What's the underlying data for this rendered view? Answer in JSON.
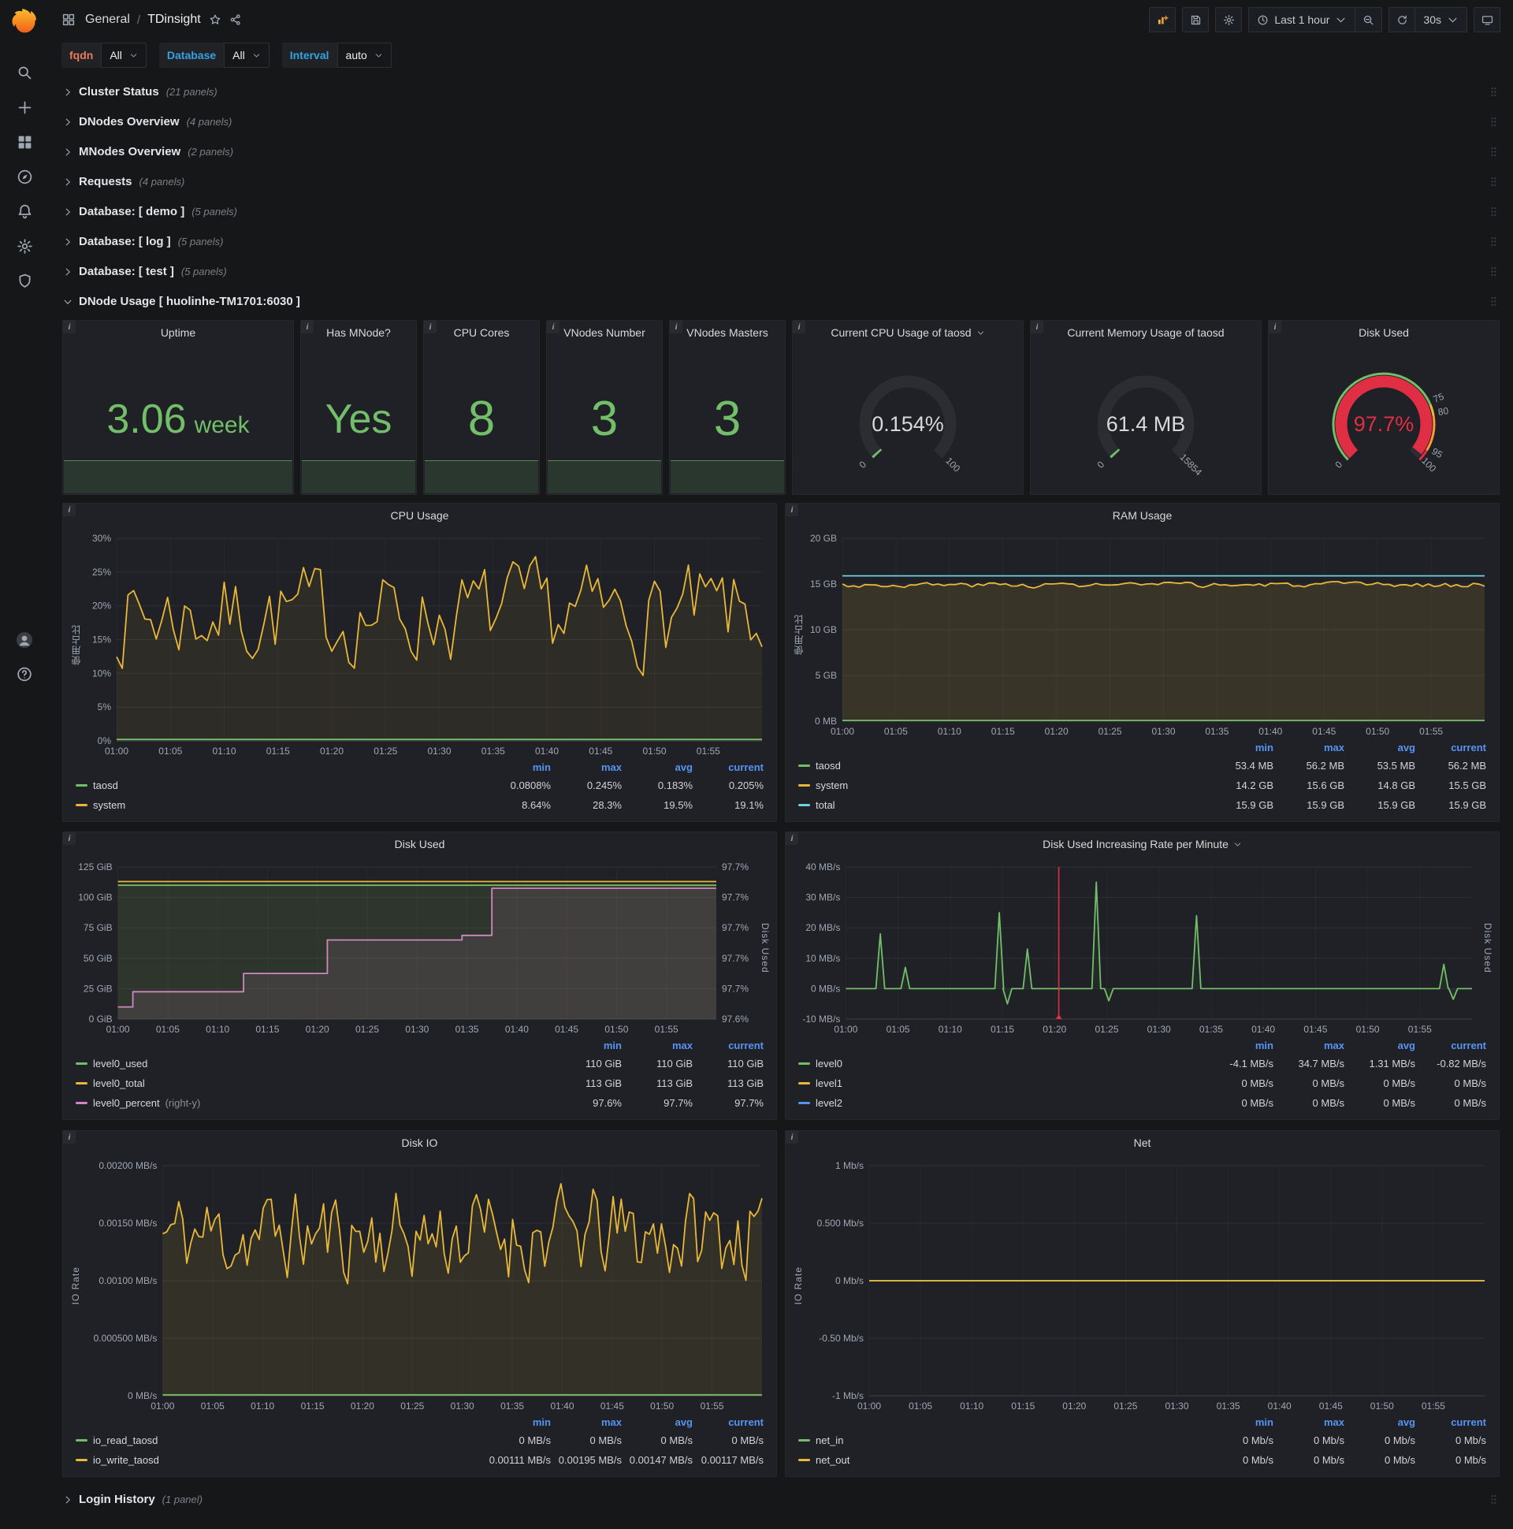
{
  "colors": {
    "green": "#73bf69",
    "yellow": "#eab839",
    "blue": "#6ed0e0",
    "series_blue": "#5794f2",
    "pink": "#d683ce",
    "red": "#e02f44",
    "legend_header": "#5794f2",
    "axis_text": "#9fa7b3",
    "fqdn_label": "#eb7b59",
    "var_label": "#33a2e5"
  },
  "navbar": {
    "breadcrumb": {
      "section": "General",
      "separator": "/",
      "title": "TDinsight"
    },
    "time_range_label": "Last 1 hour",
    "refresh_label": "30s"
  },
  "sidebar_icons": [
    {
      "name": "search-icon",
      "glyph": "search"
    },
    {
      "name": "create-icon",
      "glyph": "plus"
    },
    {
      "name": "dashboards-icon",
      "glyph": "dashboards"
    },
    {
      "name": "explore-icon",
      "glyph": "explore"
    },
    {
      "name": "alerting-icon",
      "glyph": "alerting"
    },
    {
      "name": "configuration-icon",
      "glyph": "settings"
    },
    {
      "name": "server-admin-icon",
      "glyph": "shield"
    }
  ],
  "sidebar_bottom": [
    {
      "name": "user-avatar",
      "glyph": "avatar"
    },
    {
      "name": "help-icon",
      "glyph": "help"
    }
  ],
  "variables": [
    {
      "label": "fqdn",
      "value": "All",
      "accent": "#eb7b59"
    },
    {
      "label": "Database",
      "value": "All",
      "accent": "#33a2e5"
    },
    {
      "label": "Interval",
      "value": "auto",
      "accent": "#33a2e5"
    }
  ],
  "rows_collapsed": [
    {
      "title": "Cluster Status",
      "count": "(21 panels)"
    },
    {
      "title": "DNodes Overview",
      "count": "(4 panels)"
    },
    {
      "title": "MNodes Overview",
      "count": "(2 panels)"
    },
    {
      "title": "Requests",
      "count": "(4 panels)"
    },
    {
      "title": "Database: [ demo ]",
      "count": "(5 panels)"
    },
    {
      "title": "Database: [ log ]",
      "count": "(5 panels)"
    },
    {
      "title": "Database: [ test ]",
      "count": "(5 panels)"
    }
  ],
  "expanded_row": {
    "title": "DNode Usage [ huolinhe-TM1701:6030 ]"
  },
  "bottom_row": {
    "title": "Login History",
    "count": "(1 panel)"
  },
  "stats": [
    {
      "title": "Uptime",
      "value": "3.06",
      "unit": "week"
    },
    {
      "title": "Has MNode?",
      "value": "Yes",
      "unit": ""
    },
    {
      "title": "CPU Cores",
      "value": "8",
      "unit": ""
    },
    {
      "title": "VNodes Number",
      "value": "3",
      "unit": ""
    },
    {
      "title": "VNodes Masters",
      "value": "3",
      "unit": ""
    }
  ],
  "gauges": [
    {
      "title": "Current CPU Usage of taosd",
      "caret": true,
      "value": "0.154%",
      "pct": 0.154,
      "min": "0",
      "max": "100",
      "value_color": "#d8d9da",
      "arc_color": "#73bf69",
      "thresholds": []
    },
    {
      "title": "Current Memory Usage of taosd",
      "caret": false,
      "value": "61.4 MB",
      "pct": 0.39,
      "min": "0",
      "max": "15854",
      "value_color": "#d8d9da",
      "arc_color": "#73bf69",
      "thresholds": []
    },
    {
      "title": "Disk Used",
      "caret": false,
      "value": "97.7%",
      "pct": 97.7,
      "min": "0",
      "max": "100",
      "value_color": "#e02f44",
      "arc_color": "#e02f44",
      "thresholds": [
        {
          "label": "75",
          "pct": 75
        },
        {
          "label": "80",
          "pct": 80
        },
        {
          "label": "95",
          "pct": 95
        }
      ]
    }
  ],
  "x_ticks": [
    "01:00",
    "01:05",
    "01:10",
    "01:15",
    "01:20",
    "01:25",
    "01:30",
    "01:35",
    "01:40",
    "01:45",
    "01:50",
    "01:55"
  ],
  "charts": [
    {
      "id": "cpu-usage",
      "title": "CPU Usage",
      "y_label": "使用占比",
      "y_ticks": [
        "30%",
        "25%",
        "20%",
        "15%",
        "10%",
        "5%",
        "0%"
      ],
      "legend": {
        "columns": [
          "min",
          "max",
          "avg",
          "current"
        ],
        "rows": [
          {
            "name": "taosd",
            "color": "#73bf69",
            "values": [
              "0.0808%",
              "0.245%",
              "0.183%",
              "0.205%"
            ]
          },
          {
            "name": "system",
            "color": "#eab839",
            "values": [
              "8.64%",
              "28.3%",
              "19.5%",
              "19.1%"
            ]
          }
        ]
      },
      "draw": [
        {
          "color": "#eab839",
          "mode": "noise",
          "base": 0.62,
          "amp": 0.2,
          "seed": 7,
          "n": 115,
          "clamp": [
            0.28,
            0.95
          ],
          "fill": 0.08
        },
        {
          "color": "#73bf69",
          "mode": "flat",
          "y": 0.007
        }
      ]
    },
    {
      "id": "ram-usage",
      "title": "RAM Usage",
      "y_label": "使用占比",
      "y_ticks": [
        "20 GB",
        "15 GB",
        "10 GB",
        "5 GB",
        "0 MB"
      ],
      "legend": {
        "columns": [
          "min",
          "max",
          "avg",
          "current"
        ],
        "rows": [
          {
            "name": "taosd",
            "color": "#73bf69",
            "values": [
              "53.4 MB",
              "56.2 MB",
              "53.5 MB",
              "56.2 MB"
            ]
          },
          {
            "name": "system",
            "color": "#eab839",
            "values": [
              "14.2 GB",
              "15.6 GB",
              "14.8 GB",
              "15.5 GB"
            ]
          },
          {
            "name": "total",
            "color": "#6ed0e0",
            "values": [
              "15.9 GB",
              "15.9 GB",
              "15.9 GB",
              "15.9 GB"
            ]
          }
        ]
      },
      "draw": [
        {
          "color": "#eab839",
          "mode": "noise",
          "base": 0.745,
          "amp": 0.012,
          "seed": 3,
          "n": 115,
          "clamp": [
            0.71,
            0.78
          ],
          "fill": 0.13
        },
        {
          "color": "#6ed0e0",
          "mode": "flat",
          "y": 0.795
        },
        {
          "color": "#73bf69",
          "mode": "flat",
          "y": 0.004
        }
      ]
    },
    {
      "id": "disk-used",
      "title": "Disk Used",
      "y_ticks": [
        "125 GiB",
        "100 GiB",
        "75 GiB",
        "50 GiB",
        "25 GiB",
        "0 GiB"
      ],
      "right_ticks": [
        "97.7%",
        "97.7%",
        "97.7%",
        "97.7%",
        "97.7%",
        "97.6%"
      ],
      "right_label": "Disk Used",
      "legend": {
        "columns": [
          "min",
          "max",
          "current"
        ],
        "rows": [
          {
            "name": "level0_used",
            "color": "#73bf69",
            "values": [
              "110 GiB",
              "110 GiB",
              "110 GiB"
            ]
          },
          {
            "name": "level0_total",
            "color": "#eab839",
            "values": [
              "113 GiB",
              "113 GiB",
              "113 GiB"
            ]
          },
          {
            "name": "level0_percent",
            "note": "(right-y)",
            "color": "#d683ce",
            "values": [
              "97.6%",
              "97.7%",
              "97.7%"
            ]
          }
        ]
      },
      "draw": [
        {
          "color": "#d683ce",
          "mode": "pts",
          "fill": 0.12,
          "pts": [
            [
              0,
              0.08
            ],
            [
              0.025,
              0.08
            ],
            [
              0.025,
              0.18
            ],
            [
              0.21,
              0.18
            ],
            [
              0.21,
              0.3
            ],
            [
              0.35,
              0.3
            ],
            [
              0.35,
              0.52
            ],
            [
              0.575,
              0.52
            ],
            [
              0.575,
              0.55
            ],
            [
              0.625,
              0.55
            ],
            [
              0.625,
              0.86
            ],
            [
              1,
              0.86
            ]
          ]
        },
        {
          "color": "#73bf69",
          "mode": "flat",
          "y": 0.88,
          "fill": 0.1
        },
        {
          "color": "#eab839",
          "mode": "flat",
          "y": 0.904,
          "fill": 0.04
        }
      ]
    },
    {
      "id": "disk-rate",
      "title": "Disk Used Increasing Rate per Minute",
      "title_caret": true,
      "y_ticks": [
        "40 MB/s",
        "30 MB/s",
        "20 MB/s",
        "10 MB/s",
        "0 MB/s",
        "-10 MB/s"
      ],
      "right_label": "Disk Used",
      "annotation_x": 0.34,
      "legend": {
        "columns": [
          "min",
          "max",
          "avg",
          "current"
        ],
        "rows": [
          {
            "name": "level0",
            "color": "#73bf69",
            "values": [
              "-4.1 MB/s",
              "34.7 MB/s",
              "1.31 MB/s",
              "-0.82 MB/s"
            ]
          },
          {
            "name": "level1",
            "color": "#eab839",
            "values": [
              "0 MB/s",
              "0 MB/s",
              "0 MB/s",
              "0 MB/s"
            ]
          },
          {
            "name": "level2",
            "color": "#5794f2",
            "values": [
              "0 MB/s",
              "0 MB/s",
              "0 MB/s",
              "0 MB/s"
            ]
          }
        ]
      },
      "draw": [
        {
          "color": "#73bf69",
          "mode": "spikes",
          "baseline": 0.2,
          "fill": 0.06,
          "spikes": [
            [
              0.055,
              0.56
            ],
            [
              0.095,
              0.34
            ],
            [
              0.245,
              0.7
            ],
            [
              0.29,
              0.46
            ],
            [
              0.4,
              0.9
            ],
            [
              0.56,
              0.68
            ],
            [
              0.955,
              0.36
            ]
          ],
          "dips": [
            [
              0.258,
              0.1
            ],
            [
              0.42,
              0.12
            ],
            [
              0.97,
              0.13
            ]
          ]
        }
      ]
    },
    {
      "id": "disk-io",
      "title": "Disk IO",
      "y_label": "IO Rate",
      "y_ticks": [
        "0.00200 MB/s",
        "0.00150 MB/s",
        "0.00100 MB/s",
        "0.000500 MB/s",
        "0 MB/s"
      ],
      "legend": {
        "columns": [
          "min",
          "max",
          "avg",
          "current"
        ],
        "rows": [
          {
            "name": "io_read_taosd",
            "color": "#73bf69",
            "values": [
              "0 MB/s",
              "0 MB/s",
              "0 MB/s",
              "0 MB/s"
            ]
          },
          {
            "name": "io_write_taosd",
            "color": "#eab839",
            "values": [
              "0.00111 MB/s",
              "0.00195 MB/s",
              "0.00147 MB/s",
              "0.00117 MB/s"
            ]
          }
        ]
      },
      "draw": [
        {
          "color": "#eab839",
          "mode": "noise",
          "base": 0.7,
          "amp": 0.17,
          "seed": 11,
          "n": 150,
          "clamp": [
            0.45,
            0.98
          ],
          "fill": 0.1
        },
        {
          "color": "#73bf69",
          "mode": "flat",
          "y": 0.004
        }
      ]
    },
    {
      "id": "net",
      "title": "Net",
      "y_label": "IO Rate",
      "y_ticks": [
        "1 Mb/s",
        "0.500 Mb/s",
        "0 Mb/s",
        "-0.50 Mb/s",
        "-1 Mb/s"
      ],
      "legend": {
        "columns": [
          "min",
          "max",
          "avg",
          "current"
        ],
        "rows": [
          {
            "name": "net_in",
            "color": "#73bf69",
            "values": [
              "0 Mb/s",
              "0 Mb/s",
              "0 Mb/s",
              "0 Mb/s"
            ]
          },
          {
            "name": "net_out",
            "color": "#eab839",
            "values": [
              "0 Mb/s",
              "0 Mb/s",
              "0 Mb/s",
              "0 Mb/s"
            ]
          }
        ]
      },
      "draw": [
        {
          "color": "#73bf69",
          "mode": "flat",
          "y": 0.5
        },
        {
          "color": "#eab839",
          "mode": "flat",
          "y": 0.5
        }
      ]
    }
  ]
}
